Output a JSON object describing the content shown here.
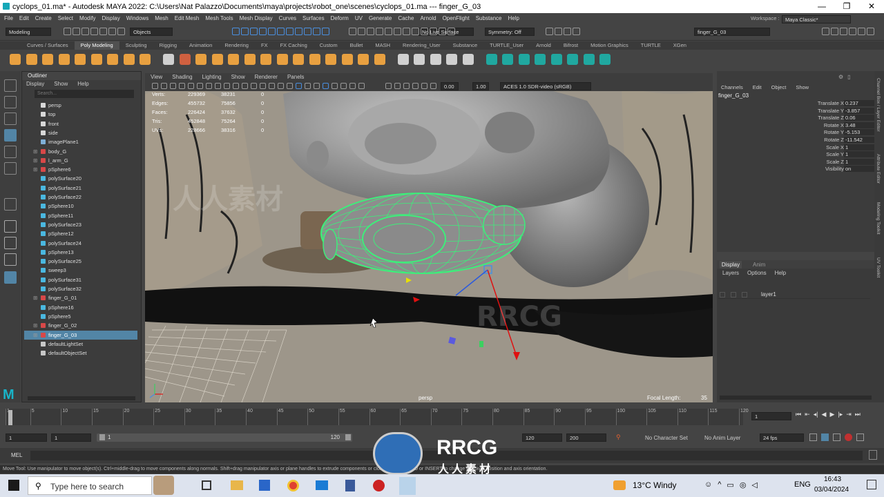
{
  "window": {
    "title": "cyclops_01.ma* - Autodesk MAYA 2022: C:\\Users\\Nat Palazzo\\Documents\\maya\\projects\\robot_one\\scenes\\cyclops_01.ma  ---  finger_G_03",
    "min": "—",
    "max": "❐",
    "close": "✕"
  },
  "menubar": [
    "File",
    "Edit",
    "Create",
    "Select",
    "Modify",
    "Display",
    "Windows",
    "Mesh",
    "Edit Mesh",
    "Mesh Tools",
    "Mesh Display",
    "Curves",
    "Surfaces",
    "Deform",
    "UV",
    "Generate",
    "Cache",
    "Arnold",
    "OpenFlight",
    "Substance",
    "Help"
  ],
  "workspace": {
    "label": "Workspace :",
    "value": "Maya Classic*"
  },
  "statusline": {
    "mode": "Modeling",
    "objects": "Objects",
    "live_surface": "No Live Surface",
    "symmetry": "Symmetry: Off",
    "object_name": "finger_G_03"
  },
  "shelf_tabs": [
    "Curves / Surfaces",
    "Poly Modeling",
    "Sculpting",
    "Rigging",
    "Animation",
    "Rendering",
    "FX",
    "FX Caching",
    "Custom",
    "Bullet",
    "MASH",
    "Rendering_User",
    "Substance",
    "TURTLE_User",
    "Arnold",
    "Bifrost",
    "Motion Graphics",
    "TURTLE",
    "XGen"
  ],
  "shelf_active": 1,
  "outliner": {
    "title": "Outliner",
    "menu": [
      "Display",
      "Show",
      "Help"
    ],
    "search_placeholder": "Search...",
    "items": [
      {
        "label": "persp",
        "type": "camera",
        "expand": false
      },
      {
        "label": "top",
        "type": "camera",
        "expand": false
      },
      {
        "label": "front",
        "type": "camera",
        "expand": false
      },
      {
        "label": "side",
        "type": "camera",
        "expand": false
      },
      {
        "label": "imagePlane1",
        "type": "image",
        "expand": false
      },
      {
        "label": "body_G",
        "type": "group",
        "expand": true
      },
      {
        "label": "l_arm_G",
        "type": "group",
        "expand": true
      },
      {
        "label": "pSphere6",
        "type": "group",
        "expand": true
      },
      {
        "label": "polySurface20",
        "type": "mesh",
        "expand": false
      },
      {
        "label": "polySurface21",
        "type": "mesh",
        "expand": false
      },
      {
        "label": "polySurface22",
        "type": "mesh",
        "expand": false
      },
      {
        "label": "pSphere10",
        "type": "mesh",
        "expand": false
      },
      {
        "label": "pSphere11",
        "type": "mesh",
        "expand": false
      },
      {
        "label": "polySurface23",
        "type": "mesh",
        "expand": false
      },
      {
        "label": "pSphere12",
        "type": "mesh",
        "expand": false
      },
      {
        "label": "polySurface24",
        "type": "mesh",
        "expand": false
      },
      {
        "label": "pSphere13",
        "type": "mesh",
        "expand": false
      },
      {
        "label": "polySurface25",
        "type": "mesh",
        "expand": false
      },
      {
        "label": "sweep3",
        "type": "mesh",
        "expand": false
      },
      {
        "label": "polySurface31",
        "type": "mesh",
        "expand": false
      },
      {
        "label": "polySurface32",
        "type": "mesh",
        "expand": false
      },
      {
        "label": "finger_G_01",
        "type": "group",
        "expand": true
      },
      {
        "label": "pSphere16",
        "type": "mesh",
        "expand": false
      },
      {
        "label": "pSphere5",
        "type": "mesh",
        "expand": false
      },
      {
        "label": "finger_G_02",
        "type": "group",
        "expand": true
      },
      {
        "label": "finger_G_03",
        "type": "group",
        "expand": true,
        "selected": true
      },
      {
        "label": "defaultLightSet",
        "type": "set",
        "expand": false
      },
      {
        "label": "defaultObjectSet",
        "type": "set",
        "expand": false
      }
    ]
  },
  "viewport": {
    "menu": [
      "View",
      "Shading",
      "Lighting",
      "Show",
      "Renderer",
      "Panels"
    ],
    "exposure": "0.00",
    "gamma": "1.00",
    "colorspace": "ACES 1.0 SDR-video (sRGB)",
    "camera": "persp",
    "focal_label": "Focal Length:",
    "focal_value": "35",
    "hud": [
      {
        "label": "Verts:",
        "a": "229369",
        "b": "38231",
        "c": "0"
      },
      {
        "label": "Edges:",
        "a": "455732",
        "b": "75856",
        "c": "0"
      },
      {
        "label": "Faces:",
        "a": "226424",
        "b": "37632",
        "c": "0"
      },
      {
        "label": "Tris:",
        "a": "452848",
        "b": "75264",
        "c": "0"
      },
      {
        "label": "UVs:",
        "a": "228666",
        "b": "38316",
        "c": "0"
      }
    ]
  },
  "channelbox": {
    "menu": [
      "Channels",
      "Edit",
      "Object",
      "Show"
    ],
    "object": "finger_G_03",
    "attrs": [
      {
        "label": "Translate X",
        "value": "0.237"
      },
      {
        "label": "Translate Y",
        "value": "-3.857"
      },
      {
        "label": "Translate Z",
        "value": "0.06"
      },
      {
        "label": "Rotate X",
        "value": "3.48"
      },
      {
        "label": "Rotate Y",
        "value": "-5.153"
      },
      {
        "label": "Rotate Z",
        "value": "-11.542"
      },
      {
        "label": "Scale X",
        "value": "1"
      },
      {
        "label": "Scale Y",
        "value": "1"
      },
      {
        "label": "Scale Z",
        "value": "1"
      },
      {
        "label": "Visibility",
        "value": "on"
      }
    ]
  },
  "layers": {
    "tabs": [
      "Display",
      "Anim"
    ],
    "menu": [
      "Layers",
      "Options",
      "Help"
    ],
    "layer_name": "layer1"
  },
  "side_tabs": [
    "Channel Box / Layer Editor",
    "Attribute Editor",
    "Modeling Toolkit",
    "UV Toolkit"
  ],
  "timeline": {
    "ticks": [
      "1",
      "5",
      "10",
      "15",
      "20",
      "25",
      "30",
      "35",
      "40",
      "45",
      "50",
      "55",
      "60",
      "65",
      "70",
      "75",
      "80",
      "85",
      "90",
      "95",
      "100",
      "105",
      "110",
      "115",
      "120"
    ],
    "current_frame": "1"
  },
  "range": {
    "start": "1",
    "anim_start": "1",
    "slider_start": "1",
    "slider_end": "120",
    "anim_end": "120",
    "end": "200",
    "character_set": "No Character Set",
    "anim_layer": "No Anim Layer",
    "fps": "24 fps"
  },
  "cmdline": {
    "label": "MEL"
  },
  "helpline": "Move Tool: Use manipulator to move object(s). Ctrl+middle-drag to move components along normals. Shift+drag manipulator axis or plane handles to extrude components or clone objects. Use D or INSERT to change the pivot position and axis orientation.",
  "taskbar": {
    "search_placeholder": "Type here to search",
    "weather": "13°C  Windy",
    "language": "ENG",
    "time": "16:43",
    "date": "03/04/2024"
  },
  "watermarks": {
    "rrcg": "RRCG",
    "cn": "人人素材"
  },
  "colors": {
    "selection": "#5285a6",
    "wireframe": "#3cf07a",
    "panel": "#444444",
    "viewport_bg": "#8a8478"
  }
}
